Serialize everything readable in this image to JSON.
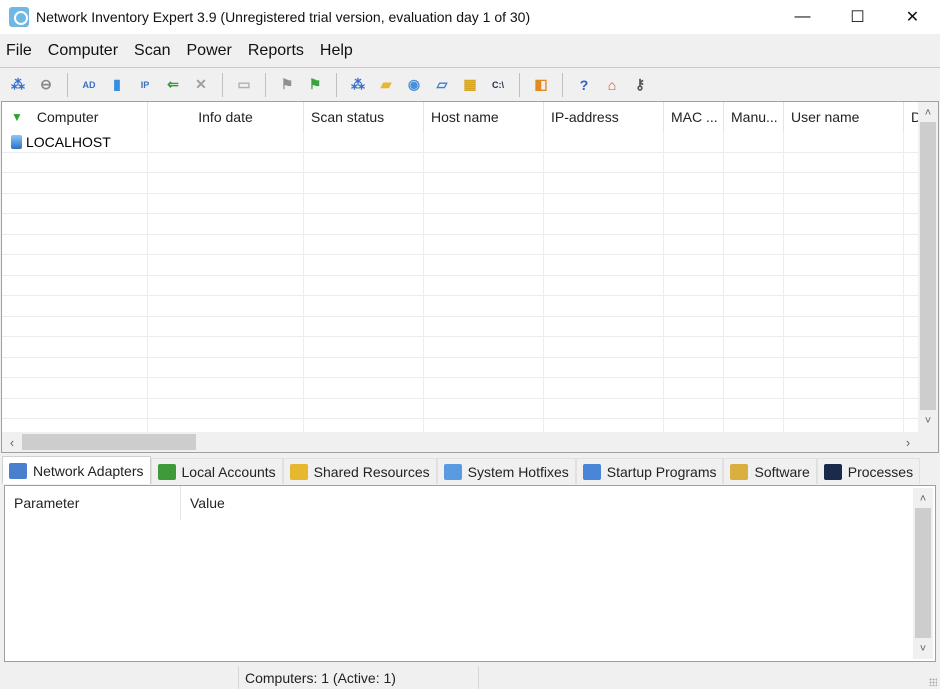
{
  "window": {
    "title": "Network Inventory Expert 3.9 (Unregistered trial version, evaluation day 1 of 30)",
    "minimize": "—",
    "maximize": "☐",
    "close": "✕"
  },
  "menu": [
    "File",
    "Computer",
    "Scan",
    "Power",
    "Reports",
    "Help"
  ],
  "toolbar": {
    "groups": [
      [
        {
          "icon": "add-computers-icon",
          "glyph": "⁂",
          "color": "#3a6fc9"
        },
        {
          "icon": "remove-computer-icon",
          "glyph": "⊖",
          "color": "#888888"
        }
      ],
      [
        {
          "icon": "add-from-ad-icon",
          "glyph": "AD",
          "color": "#3a6fc9"
        },
        {
          "icon": "add-computer-icon",
          "glyph": "▮",
          "color": "#3a8ee0"
        },
        {
          "icon": "add-by-ip-icon",
          "glyph": "IP",
          "color": "#3a6fc9"
        },
        {
          "icon": "import-computers-icon",
          "glyph": "⇐",
          "color": "#2e9e3a"
        },
        {
          "icon": "delete-icon",
          "glyph": "✕",
          "color": "#a0a0a0"
        }
      ],
      [
        {
          "icon": "properties-icon",
          "glyph": "▭",
          "color": "#b0b0b0"
        }
      ],
      [
        {
          "icon": "scan-disabled-icon",
          "glyph": "⚑",
          "color": "#909090"
        },
        {
          "icon": "scan-icon",
          "glyph": "⚑",
          "color": "#3aa33a"
        }
      ],
      [
        {
          "icon": "network-adapters-icon",
          "glyph": "⁂",
          "color": "#3a6fc9"
        },
        {
          "icon": "shared-folders-icon",
          "glyph": "▰",
          "color": "#e6b830"
        },
        {
          "icon": "hotfixes-icon",
          "glyph": "◉",
          "color": "#4a8fd8"
        },
        {
          "icon": "startup-icon",
          "glyph": "▱",
          "color": "#3a7fd8"
        },
        {
          "icon": "software-icon",
          "glyph": "▦",
          "color": "#d9a520"
        },
        {
          "icon": "processes-icon",
          "glyph": "C:\\",
          "color": "#1a2a4a"
        }
      ],
      [
        {
          "icon": "report-icon",
          "glyph": "◧",
          "color": "#e08a20"
        }
      ],
      [
        {
          "icon": "help-icon",
          "glyph": "?",
          "color": "#2a5fc8"
        },
        {
          "icon": "home-icon",
          "glyph": "⌂",
          "color": "#d0502a"
        },
        {
          "icon": "register-key-icon",
          "glyph": "⚷",
          "color": "#555555"
        }
      ]
    ]
  },
  "grid": {
    "columns": [
      {
        "label": "Computer"
      },
      {
        "label": "Info date"
      },
      {
        "label": "Scan status"
      },
      {
        "label": "Host name"
      },
      {
        "label": "IP-address"
      },
      {
        "label": "MAC ..."
      },
      {
        "label": "Manu..."
      },
      {
        "label": "User name"
      },
      {
        "label": "D"
      }
    ],
    "rows": [
      [
        "LOCALHOST",
        "",
        "",
        "",
        "",
        "",
        "",
        "",
        ""
      ]
    ],
    "empty_rows": 14
  },
  "tabs": [
    {
      "label": "Network Adapters",
      "icon": "network-adapters-icon",
      "color": "#4a7fd0",
      "active": true
    },
    {
      "label": "Local Accounts",
      "icon": "users-icon",
      "color": "#3f9a3a",
      "active": false
    },
    {
      "label": "Shared Resources",
      "icon": "shared-folder-icon",
      "color": "#e6b830",
      "active": false
    },
    {
      "label": "System Hotfixes",
      "icon": "hotfixes-icon",
      "color": "#5a9ae0",
      "active": false
    },
    {
      "label": "Startup Programs",
      "icon": "startup-icon",
      "color": "#4a86d8",
      "active": false
    },
    {
      "label": "Software",
      "icon": "software-icon",
      "color": "#d9b040",
      "active": false
    },
    {
      "label": "Processes",
      "icon": "console-icon",
      "color": "#1a2a4a",
      "active": false
    }
  ],
  "detail": {
    "columns": [
      "Parameter",
      "Value"
    ]
  },
  "status": {
    "left": "",
    "computers": "Computers: 1 (Active: 1)",
    "right": ""
  },
  "scroll": {
    "up": "˄",
    "down": "˅",
    "left": "‹",
    "right": "›"
  }
}
